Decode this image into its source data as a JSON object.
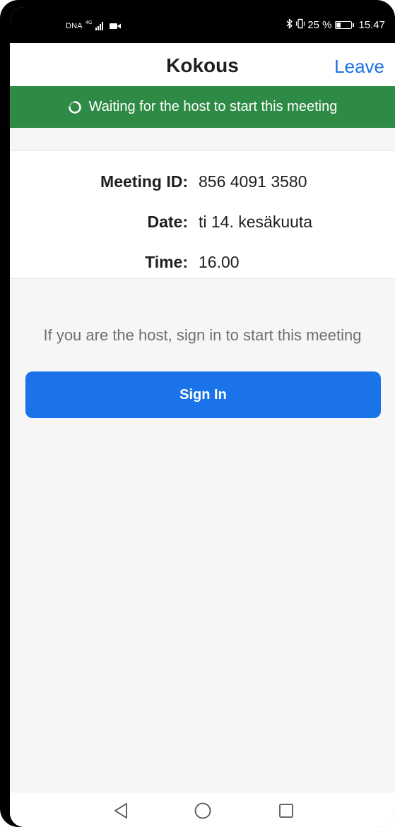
{
  "status_bar": {
    "carrier": "DNA",
    "network_type": "4G",
    "battery_percent": "25 %",
    "battery_level": 0.25,
    "time": "15.47"
  },
  "header": {
    "title": "Kokous",
    "leave_label": "Leave"
  },
  "banner": {
    "text": "Waiting for the host to start this meeting",
    "color": "#2e8b45"
  },
  "meeting_info": {
    "rows": [
      {
        "label": "Meeting ID:",
        "value": "856 4091 3580"
      },
      {
        "label": "Date:",
        "value": "ti 14. kesäkuuta"
      },
      {
        "label": "Time:",
        "value": "16.00"
      }
    ]
  },
  "host_hint": "If you are the host, sign in to start this meeting",
  "sign_in": {
    "label": "Sign In",
    "color": "#1a73e8"
  },
  "nav_bar": {
    "icons": [
      "back-triangle-icon",
      "home-circle-icon",
      "recents-square-icon"
    ]
  }
}
